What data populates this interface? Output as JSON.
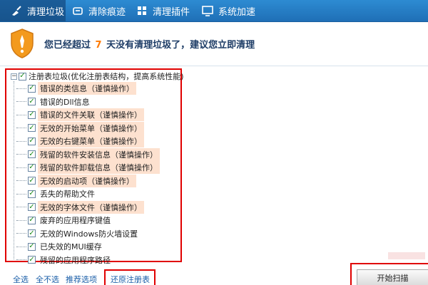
{
  "tabs": [
    {
      "label": "清理垃圾",
      "icon": "broom-icon",
      "active": true
    },
    {
      "label": "清除痕迹",
      "icon": "eraser-icon",
      "active": false
    },
    {
      "label": "清理插件",
      "icon": "plugin-icon",
      "active": false
    },
    {
      "label": "系统加速",
      "icon": "monitor-icon",
      "active": false
    }
  ],
  "notice": {
    "prefix": "您已经超过",
    "days": "7",
    "suffix": "天没有清理垃圾了，建议您立即清理",
    "icon": "shield-exclamation-icon"
  },
  "tree": {
    "root_label": "注册表垃圾(优化注册表结构，提高系统性能)",
    "items": [
      {
        "label": "错误的类信息（谨慎操作）",
        "caution": true
      },
      {
        "label": "错误的Dll信息",
        "caution": false
      },
      {
        "label": "错误的文件关联（谨慎操作）",
        "caution": true
      },
      {
        "label": "无效的开始菜单（谨慎操作）",
        "caution": true
      },
      {
        "label": "无效的右键菜单（谨慎操作）",
        "caution": true
      },
      {
        "label": "残留的软件安装信息（谨慎操作）",
        "caution": true
      },
      {
        "label": "残留的软件卸载信息（谨慎操作）",
        "caution": true
      },
      {
        "label": "无效的启动项（谨慎操作）",
        "caution": true
      },
      {
        "label": "丢失的帮助文件",
        "caution": false
      },
      {
        "label": "无效的字体文件（谨慎操作）",
        "caution": true
      },
      {
        "label": "废弃的应用程序键值",
        "caution": false
      },
      {
        "label": "无效的Windows防火墙设置",
        "caution": false
      },
      {
        "label": "已失效的MUI缓存",
        "caution": false
      },
      {
        "label": "残留的应用程序路径",
        "caution": false
      }
    ]
  },
  "bottom": {
    "select_all": "全选",
    "select_none": "全不选",
    "recommended": "推荐选项",
    "restore_registry": "还原注册表",
    "start_scan": "开始扫描"
  },
  "colors": {
    "tab_bar": "#2d8bd2",
    "highlight_box": "#e00000",
    "days_accent": "#ff7a00",
    "caution_bg": "#fde1cf"
  }
}
